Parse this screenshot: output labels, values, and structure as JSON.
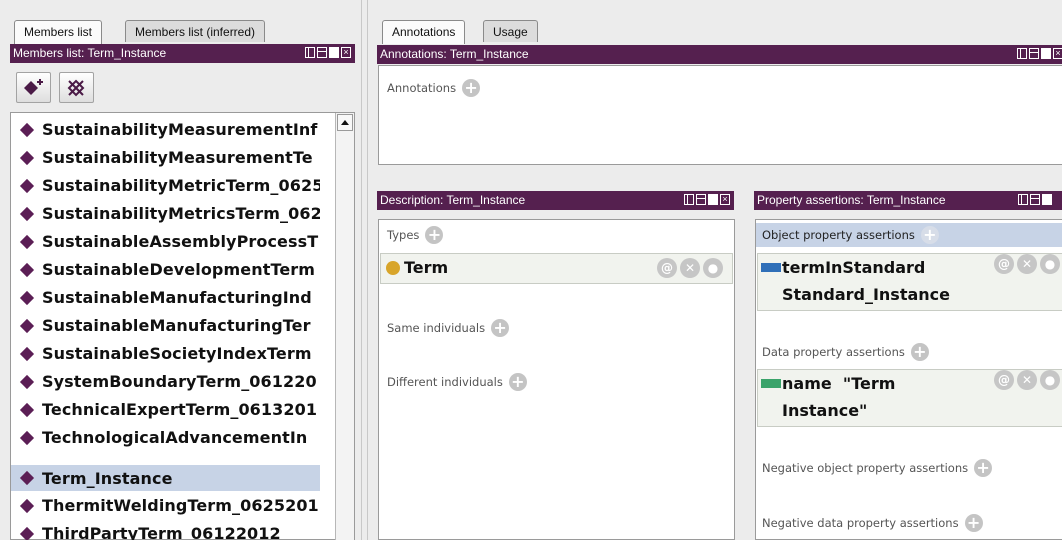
{
  "left": {
    "tabs": [
      {
        "label": "Members list",
        "active": true
      },
      {
        "label": "Members list (inferred)",
        "active": false
      }
    ],
    "header": "Members list: Term_Instance",
    "toolbar": {
      "add_icon": "add-individual-icon",
      "delete_icon": "delete-individual-icon"
    },
    "members": [
      "SustainabilityMeasurementInf",
      "SustainabilityMeasurementTe",
      "SustainabilityMetricTerm_0625",
      "SustainabilityMetricsTerm_062",
      "SustainableAssemblyProcessT",
      "SustainableDevelopmentTerm",
      "SustainableManufacturingInd",
      "SustainableManufacturingTer",
      "SustainableSocietyIndexTerm",
      "SystemBoundaryTerm_061220",
      "TechnicalExpertTerm_0613201",
      "TechnologicalAdvancementIn",
      "Term_Instance",
      "ThermitWeldingTerm_0625201",
      "ThirdPartyTerm_06122012"
    ],
    "selected_index": 12
  },
  "right": {
    "tabs": [
      {
        "label": "Annotations",
        "active": true
      },
      {
        "label": "Usage",
        "active": false
      }
    ],
    "annotations": {
      "header": "Annotations: Term_Instance",
      "label": "Annotations"
    },
    "description": {
      "header": "Description: Term_Instance",
      "types_label": "Types",
      "type_value": "Term",
      "same_label": "Same individuals",
      "different_label": "Different individuals"
    },
    "property": {
      "header": "Property assertions: Term_Instance",
      "object_label": "Object property assertions",
      "object_line1": "termInStandard",
      "object_line2": "Standard_Instance",
      "data_label": "Data property assertions",
      "data_line1": "name  \"Term",
      "data_line2": "Instance\"",
      "neg_object_label": "Negative object property assertions",
      "neg_data_label": "Negative data property assertions"
    },
    "colors": {
      "header": "#55204f",
      "object_property": "#2f6fb8",
      "data_property": "#3aa36a",
      "class_circle": "#d8a52a",
      "selection": "#c7d3e6"
    }
  }
}
